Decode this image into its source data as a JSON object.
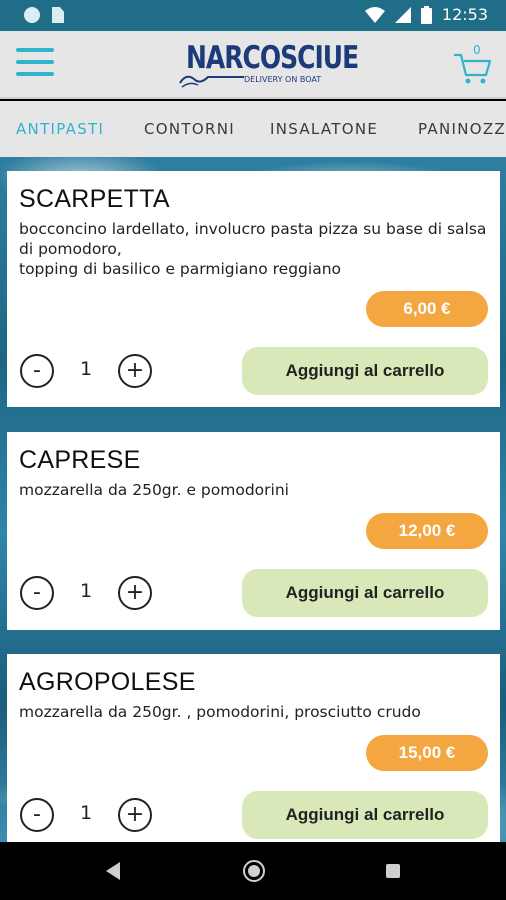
{
  "status_bar": {
    "time": "12:53",
    "icons": [
      "notification-dot-icon",
      "sim-card-icon",
      "wifi-icon",
      "signal-icon",
      "battery-icon"
    ]
  },
  "header": {
    "logo_name": "NARCOSCIUE",
    "logo_tagline": "DELIVERY ON BOAT",
    "cart_count": "0",
    "icons": [
      "menu-icon",
      "cart-icon"
    ]
  },
  "tabs": [
    {
      "label": "ANTIPASTI",
      "active": true
    },
    {
      "label": "CONTORNI",
      "active": false
    },
    {
      "label": "INSALATONE",
      "active": false
    },
    {
      "label": "PANINOZZ",
      "active": false
    }
  ],
  "products": [
    {
      "title": "SCARPETTA",
      "description": "bocconcino lardellato, involucro pasta pizza su base di salsa di pomodoro,\ntopping di basilico e parmigiano reggiano",
      "price": "6,00 €",
      "quantity": "1",
      "add_label": "Aggiungi al carrello"
    },
    {
      "title": "CAPRESE",
      "description": "mozzarella da 250gr. e pomodorini",
      "price": "12,00 €",
      "quantity": "1",
      "add_label": "Aggiungi al carrello"
    },
    {
      "title": "AGROPOLESE",
      "description": "mozzarella da 250gr. , pomodorini, prosciutto crudo",
      "price": "15,00 €",
      "quantity": "1",
      "add_label": "Aggiungi al carrello"
    }
  ],
  "qty_controls": {
    "minus": "-",
    "plus": "+"
  },
  "colors": {
    "status_bar": "#1f6d86",
    "accent": "#31b3cc",
    "price_badge": "#f4a640",
    "add_button": "#d9e8b9",
    "logo": "#1d3b7a"
  },
  "nav_bar": {
    "icons": [
      "back-icon",
      "home-icon",
      "recent-apps-icon"
    ]
  }
}
